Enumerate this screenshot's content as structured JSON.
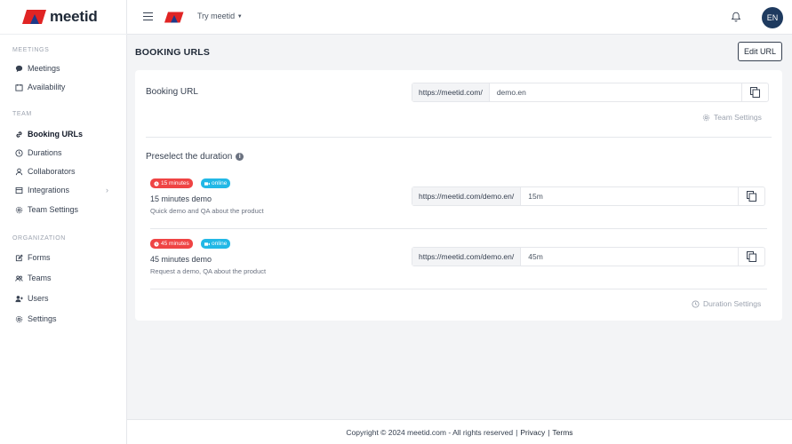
{
  "brand": {
    "name": "meetid",
    "logo_color": "#e02424"
  },
  "topbar": {
    "try_label": "Try meetid",
    "avatar_initials": "EN"
  },
  "sidebar": {
    "sections": [
      {
        "label": "MEETINGS"
      },
      {
        "label": "TEAM"
      },
      {
        "label": "ORGANIZATION"
      }
    ],
    "items": [
      {
        "label": "Meetings",
        "icon": "chat-bubble-icon"
      },
      {
        "label": "Availability",
        "icon": "calendar-icon"
      },
      {
        "label": "Booking URLs",
        "icon": "link-icon",
        "active": true
      },
      {
        "label": "Durations",
        "icon": "clock-icon"
      },
      {
        "label": "Collaborators",
        "icon": "user-icon"
      },
      {
        "label": "Integrations",
        "icon": "puzzle-icon"
      },
      {
        "label": "Team Settings",
        "icon": "gear-icon"
      },
      {
        "label": "Forms",
        "icon": "edit-icon"
      },
      {
        "label": "Teams",
        "icon": "users-icon"
      },
      {
        "label": "Users",
        "icon": "user-plus-icon"
      },
      {
        "label": "Settings",
        "icon": "gear-icon"
      }
    ]
  },
  "page": {
    "title": "BOOKING URLS",
    "edit_button": "Edit URL"
  },
  "booking": {
    "label": "Booking URL",
    "prefix": "https://meetid.com/",
    "value": "demo.en",
    "team_settings_link": "Team Settings"
  },
  "durations": {
    "title": "Preselect the duration",
    "settings_link": "Duration Settings",
    "items": [
      {
        "badge_time": "15 minutes",
        "badge_mode": "online",
        "name": "15 minutes demo",
        "description": "Quick demo and QA about the product",
        "prefix": "https://meetid.com/demo.en/",
        "value": "15m"
      },
      {
        "badge_time": "45 minutes",
        "badge_mode": "online",
        "name": "45 minutes demo",
        "description": "Request a demo, QA about the product",
        "prefix": "https://meetid.com/demo.en/",
        "value": "45m"
      }
    ]
  },
  "footer": {
    "copyright": "Copyright © 2024 meetid.com - All rights reserved",
    "privacy": "Privacy",
    "terms": "Terms"
  }
}
